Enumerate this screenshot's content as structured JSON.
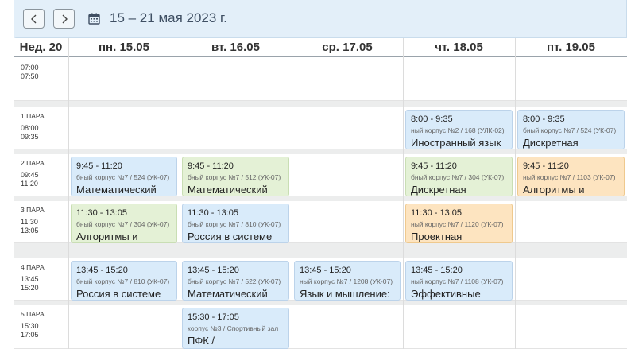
{
  "toolbar": {
    "prev_label": "‹",
    "next_label": "›",
    "calendar_icon": "calendar-icon",
    "title": "15 – 21 мая 2023 г."
  },
  "header": {
    "week": "Нед. 20",
    "days": [
      "пн. 15.05",
      "вт. 16.05",
      "ср. 17.05",
      "чт. 18.05",
      "пт. 19.05"
    ]
  },
  "periods": [
    {
      "name": "",
      "start": "07:00",
      "end": "07:50"
    },
    {
      "name": "1 ПАРА",
      "start": "08:00",
      "end": "09:35"
    },
    {
      "name": "2 ПАРА",
      "start": "09:45",
      "end": "11:20"
    },
    {
      "name": "3 ПАРА",
      "start": "11:30",
      "end": "13:05"
    },
    {
      "name": "4 ПАРА",
      "start": "13:45",
      "end": "15:20"
    },
    {
      "name": "5 ПАРА",
      "start": "15:30",
      "end": "17:05"
    }
  ],
  "events": [
    {
      "time": "8:00 - 9:35",
      "room": "ный корпус №2 / 168 (УЛК-02)",
      "name": "Иностранный язык",
      "color": "blue"
    },
    {
      "time": "8:00 - 9:35",
      "room": "бный корпус №7 / 524 (УК-07)",
      "name": "Дискретная",
      "color": "blue"
    },
    {
      "time": "9:45 - 11:20",
      "room": "бный корпус №7 / 524 (УК-07)",
      "name": "Математический",
      "color": "blue"
    },
    {
      "time": "9:45 - 11:20",
      "room": "бный корпус №7 / 512 (УК-07)",
      "name": "Математический",
      "color": "green"
    },
    {
      "time": "9:45 - 11:20",
      "room": "бный корпус №7 / 304 (УК-07)",
      "name": "Дискретная",
      "color": "green"
    },
    {
      "time": "9:45 - 11:20",
      "room": "ный корпус №7 / 1103 (УК-07)",
      "name": "Алгоритмы и",
      "color": "orange"
    },
    {
      "time": "11:30 - 13:05",
      "room": "бный корпус №7 / 304 (УК-07)",
      "name": "Алгоритмы и",
      "color": "green"
    },
    {
      "time": "11:30 - 13:05",
      "room": "бный корпус №7 / 810 (УК-07)",
      "name": "Россия в системе",
      "color": "blue"
    },
    {
      "time": "11:30 - 13:05",
      "room": "ный корпус №7 / 1120 (УК-07)",
      "name": "Проектная",
      "color": "orange"
    },
    {
      "time": "13:45 - 15:20",
      "room": "бный корпус №7 / 810 (УК-07)",
      "name": "Россия в системе",
      "color": "blue"
    },
    {
      "time": "13:45 - 15:20",
      "room": "бный корпус №7 / 522 (УК-07)",
      "name": "Математический",
      "color": "blue"
    },
    {
      "time": "13:45 - 15:20",
      "room": "ный корпус №7 / 1208 (УК-07)",
      "name": "Язык и мышление:",
      "color": "blue"
    },
    {
      "time": "13:45 - 15:20",
      "room": "ный корпус №7 / 1108 (УК-07)",
      "name": "Эффективные",
      "color": "blue"
    },
    {
      "time": "15:30 - 17:05",
      "room": "корпус №3 / Спортивный зал",
      "name": "ПФК /",
      "color": "blue"
    }
  ]
}
